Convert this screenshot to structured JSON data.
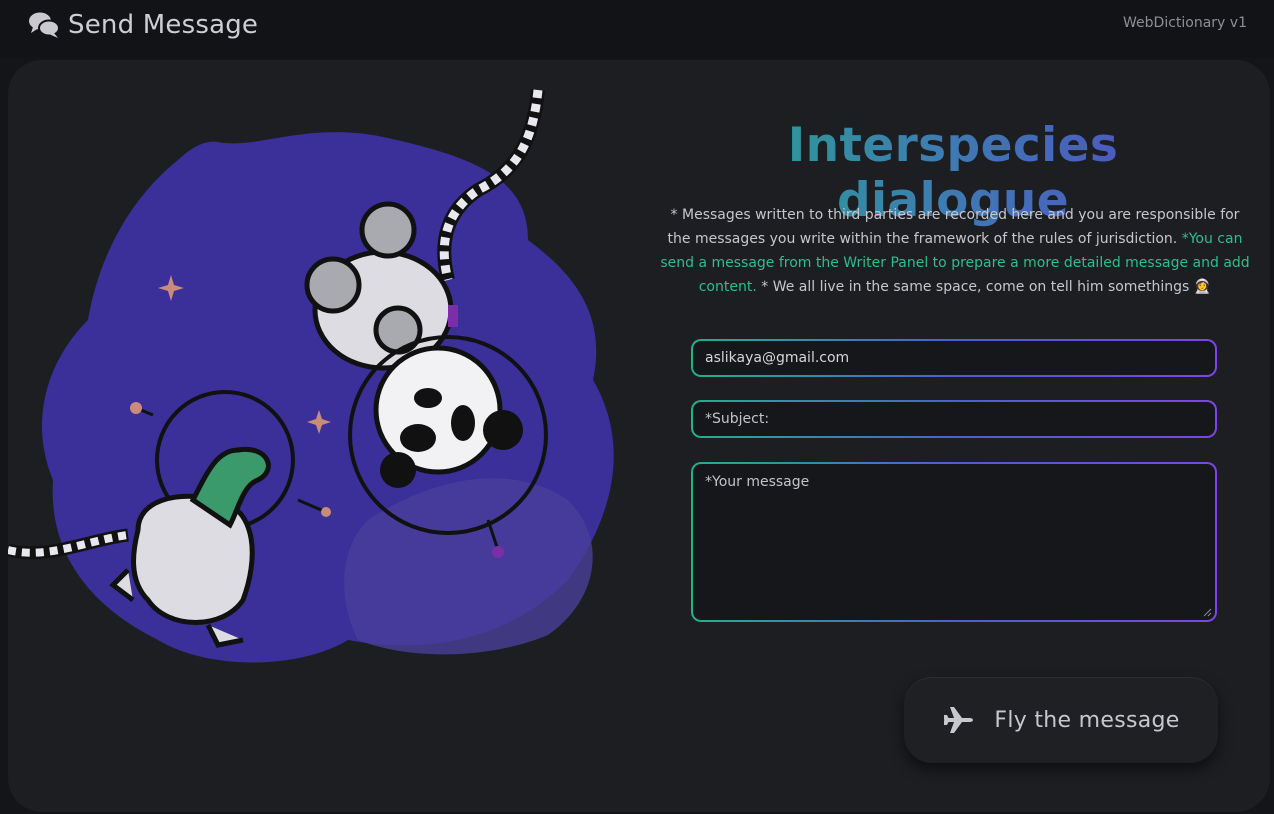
{
  "header": {
    "title": "Send Message",
    "version": "WebDictionary v1",
    "icon": "chat-bubbles-icon"
  },
  "main": {
    "heading": "Interspecies dialogue",
    "notice_part1": "* Messages written to third parties are recorded here and you are responsible for the messages you write within the framework of the rules of jurisdiction. ",
    "notice_green": "*You can send a message from the Writer Panel to prepare a more detailed message and add content.",
    "notice_part2": " * We all live in the same space, come on tell him somethings 👩‍🚀"
  },
  "form": {
    "email_value": "aslikaya@gmail.com",
    "subject_placeholder": "*Subject:",
    "message_placeholder": "*Your message",
    "send_label": "Fly the message",
    "send_icon": "airplane-icon"
  },
  "colors": {
    "heading_start": "#22a886",
    "heading_end": "#5346c8",
    "highlight": "#2dbf8c",
    "blob": "#3b2f9a"
  }
}
